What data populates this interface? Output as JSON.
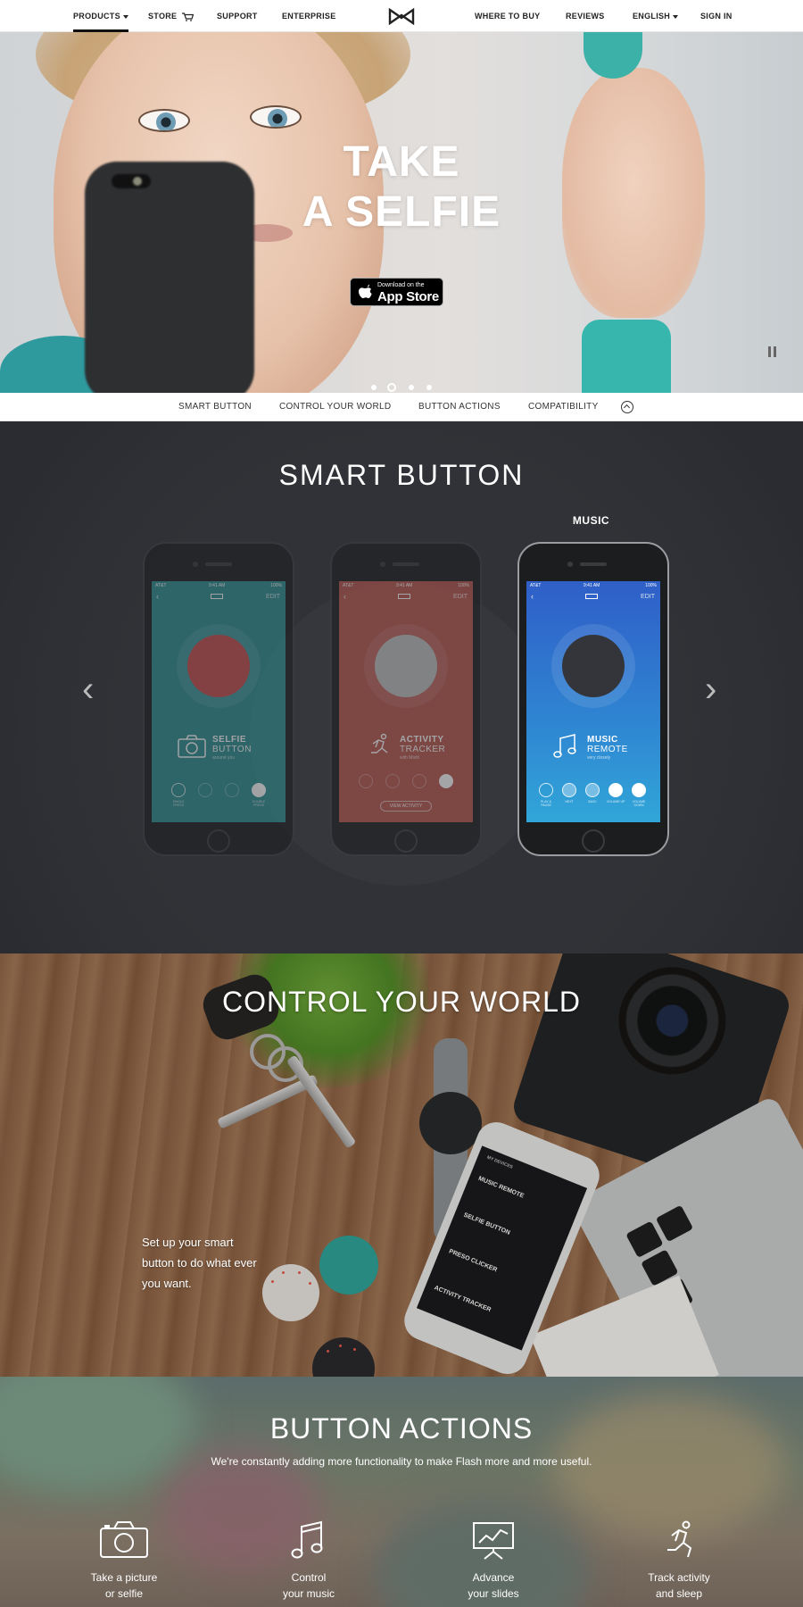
{
  "nav": {
    "left": [
      "PRODUCTS",
      "STORE",
      "SUPPORT",
      "ENTERPRISE"
    ],
    "right": [
      "WHERE TO BUY",
      "REVIEWS",
      "ENGLISH",
      "SIGN IN"
    ],
    "logo_icon": "misfit-logo-icon"
  },
  "hero": {
    "title_line1": "TAKE",
    "title_line2": "A SELFIE",
    "appstore_small": "Download on the",
    "appstore_big": "App Store",
    "carousel_active": 1,
    "carousel_count": 4
  },
  "subnav": {
    "items": [
      "SMART BUTTON",
      "CONTROL YOUR WORLD",
      "BUTTON ACTIONS",
      "COMPATIBILITY"
    ]
  },
  "smart_button": {
    "title": "SMART BUTTON",
    "active_label": "MUSIC",
    "phones": [
      {
        "name1": "SELFIE",
        "name2": "BUTTON",
        "sub": "around you",
        "screen_color": "#2b8f92",
        "disc_color": "#c23a3c",
        "status_left": "AT&T",
        "status_time": "9:41 AM",
        "status_right": "100%",
        "edit": "EDIT",
        "options": [
          "SINGLE PRESS",
          "",
          "",
          "DOUBLE PRESS"
        ]
      },
      {
        "name1": "ACTIVITY",
        "name2": "TRACKER",
        "sub": "with Misfit",
        "screen_color": "#b8554c",
        "disc_color": "#b9b9b9",
        "status_left": "AT&T",
        "status_time": "9:41 AM",
        "status_right": "100%",
        "edit": "EDIT",
        "view_button": "VIEW ACTIVITY"
      },
      {
        "name1": "MUSIC",
        "name2": "REMOTE",
        "sub": "very closely",
        "screen_color": "#2f7fd0",
        "disc_color": "#1d1f24",
        "status_left": "AT&T",
        "status_time": "9:41 AM",
        "status_right": "100%",
        "edit": "EDIT",
        "options": [
          "PLAY & PAUSE",
          "NEXT",
          "BACK",
          "VOLUME UP",
          "VOLUME DOWN"
        ]
      }
    ]
  },
  "world": {
    "title": "CONTROL YOUR WORLD",
    "text": "Set up your smart button to do what ever you want.",
    "phone_header": "MY DEVICES",
    "phone_rows": [
      "MUSIC REMOTE",
      "SELFIE BUTTON",
      "PRESO CLICKER",
      "ACTIVITY TRACKER"
    ]
  },
  "actions": {
    "title": "BUTTON ACTIONS",
    "subtitle": "We're constantly adding more functionality to make Flash more and more useful.",
    "items": [
      {
        "line1": "Take a picture",
        "line2": "or selfie",
        "icon": "camera-icon"
      },
      {
        "line1": "Control",
        "line2": "your music",
        "icon": "music-note-icon"
      },
      {
        "line1": "Advance",
        "line2": "your slides",
        "icon": "presentation-icon"
      },
      {
        "line1": "Track activity",
        "line2": "and sleep",
        "icon": "running-person-icon"
      }
    ]
  }
}
